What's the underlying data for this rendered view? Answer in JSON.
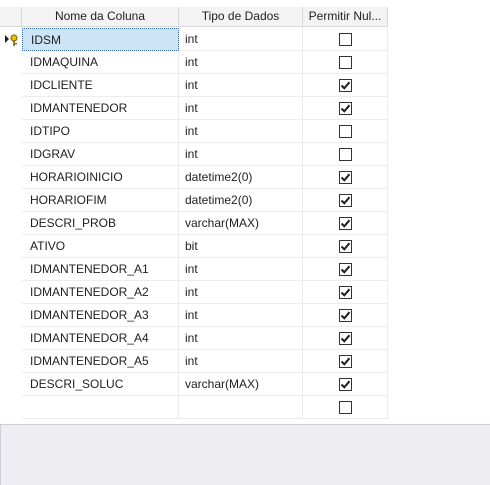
{
  "columns": {
    "name": "Nome da Coluna",
    "type": "Tipo de Dados",
    "nulls": "Permitir Nul..."
  },
  "rows": [
    {
      "name": "IDSM",
      "type": "int",
      "nullable": false,
      "primary_key": true,
      "selected": true
    },
    {
      "name": "IDMAQUINA",
      "type": "int",
      "nullable": false
    },
    {
      "name": "IDCLIENTE",
      "type": "int",
      "nullable": true
    },
    {
      "name": "IDMANTENEDOR",
      "type": "int",
      "nullable": true
    },
    {
      "name": "IDTIPO",
      "type": "int",
      "nullable": false
    },
    {
      "name": "IDGRAV",
      "type": "int",
      "nullable": false
    },
    {
      "name": "HORARIOINICIO",
      "type": "datetime2(0)",
      "nullable": true
    },
    {
      "name": "HORARIOFIM",
      "type": "datetime2(0)",
      "nullable": true
    },
    {
      "name": "DESCRI_PROB",
      "type": "varchar(MAX)",
      "nullable": true
    },
    {
      "name": "ATIVO",
      "type": "bit",
      "nullable": true
    },
    {
      "name": "IDMANTENEDOR_A1",
      "type": "int",
      "nullable": true
    },
    {
      "name": "IDMANTENEDOR_A2",
      "type": "int",
      "nullable": true
    },
    {
      "name": "IDMANTENEDOR_A3",
      "type": "int",
      "nullable": true
    },
    {
      "name": "IDMANTENEDOR_A4",
      "type": "int",
      "nullable": true
    },
    {
      "name": "IDMANTENEDOR_A5",
      "type": "int",
      "nullable": true
    },
    {
      "name": "DESCRI_SOLUC",
      "type": "varchar(MAX)",
      "nullable": true
    },
    {
      "name": "",
      "type": "",
      "nullable": false
    }
  ],
  "icons": {
    "current_row": "row-pointer-icon",
    "primary_key": "key-icon",
    "checked": "checkmark-icon"
  }
}
